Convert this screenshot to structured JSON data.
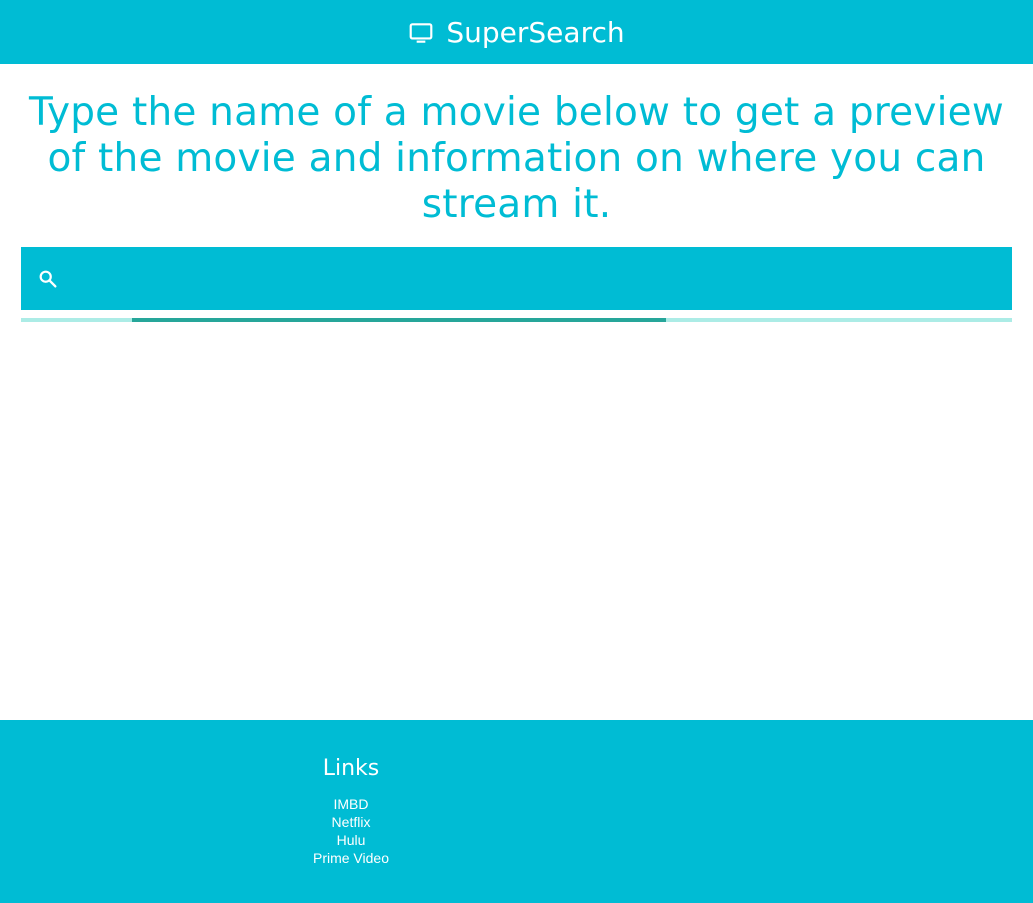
{
  "navbar": {
    "brand_icon": "tv-icon",
    "brand_text": "SuperSearch"
  },
  "main": {
    "headline": "Type the name of a movie below to get a preview of the movie and information on where you can stream it."
  },
  "search": {
    "icon": "search-icon",
    "value": "",
    "placeholder": "",
    "loading_progress": "indeterminate"
  },
  "footer": {
    "title": "Links",
    "links": [
      {
        "label": "IMBD"
      },
      {
        "label": "Netflix"
      },
      {
        "label": "Hulu"
      },
      {
        "label": "Prime Video"
      }
    ]
  },
  "colors": {
    "primary": "#00bcd4",
    "progress_track": "#acece6",
    "progress_bar": "#26a69a",
    "text_on_primary": "#ffffff"
  }
}
